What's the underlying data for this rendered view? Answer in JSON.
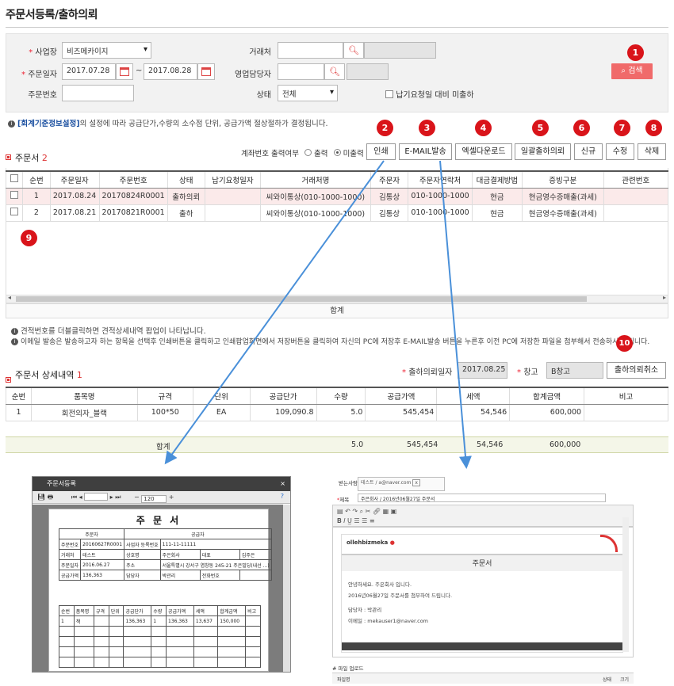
{
  "page_title": "주문서등록/출하의뢰",
  "search": {
    "business_label": "사업장",
    "business_value": "비즈메카이지",
    "order_date_label": "주문일자",
    "date_from": "2017.07.28",
    "date_to": "2017.08.28",
    "date_sep": "~",
    "order_no_label": "주문번호",
    "client_label": "거래처",
    "sales_rep_label": "영업담당자",
    "status_label": "상태",
    "status_value": "전체",
    "undelivered_label": "납기요청일 대비 미출하",
    "search_button": "검색",
    "search_icon": "magnifier-icon"
  },
  "info_line": {
    "link": "[회계기준정보설정]",
    "text": "의 설정에 따라 공급단가,수량의 소수점 단위, 공급가액 절상절하가 결정됩니다."
  },
  "orders": {
    "title": "주문서",
    "count": "2",
    "account_print_label": "계좌번호 출력여부",
    "radio_print": "출력",
    "radio_noprint": "미출력",
    "buttons": {
      "print": "인쇄",
      "email": "E-MAIL발송",
      "excel": "엑셀다운로드",
      "bulk": "일괄출하의뢰",
      "new": "신규",
      "edit": "수정",
      "delete": "삭제"
    },
    "columns": [
      "순번",
      "주문일자",
      "주문번호",
      "상태",
      "납기요청일자",
      "거래처명",
      "주문자",
      "주문자연락처",
      "대금결제방법",
      "증빙구분",
      "관련번호"
    ],
    "rows": [
      [
        "1",
        "2017.08.24",
        "20170824R0001",
        "출하의뢰",
        "",
        "씨와이통상(010-1000-1000)",
        "김통상",
        "010-1000-1000",
        "현금",
        "현금영수증매출(과세)",
        ""
      ],
      [
        "2",
        "2017.08.21",
        "20170821R0001",
        "출하",
        "",
        "씨와이통상(010-1000-1000)",
        "김통상",
        "010-1000-1000",
        "현금",
        "현금영수증매출(과세)",
        ""
      ]
    ],
    "sum_label": "합계"
  },
  "notes": [
    "견적번호를 더블클릭하면 견적상세내역 팝업이 나타납니다.",
    "이메일 발송은 발송하고자 하는 항목을 선택후 인쇄버튼을 클릭하고 인쇄팝업화면에서 저장버튼을 클릭하여 자신의 PC에 저장후 E-MAIL발송 버튼을 누른후 이전 PC에 저장한 파일을 첨부해서 전송하시면 됩니다."
  ],
  "detail": {
    "title": "주문서 상세내역",
    "count": "1",
    "request_date_label": "출하의뢰일자",
    "request_date": "2017.08.25",
    "warehouse_label": "창고",
    "warehouse": "B창고",
    "cancel_button": "출하의뢰취소",
    "columns": [
      "순번",
      "품목명",
      "규격",
      "단위",
      "공급단가",
      "수량",
      "공급가액",
      "세액",
      "합계금액",
      "비고"
    ],
    "rows": [
      [
        "1",
        "회전의자_블랙",
        "100*50",
        "EA",
        "109,090.8",
        "5.0",
        "545,454",
        "54,546",
        "600,000",
        ""
      ]
    ],
    "sum": {
      "label": "합계",
      "qty": "5.0",
      "supply": "545,454",
      "tax": "54,546",
      "total": "600,000"
    }
  },
  "badges": [
    "1",
    "2",
    "3",
    "4",
    "5",
    "6",
    "7",
    "8",
    "9",
    "10"
  ],
  "print_popup": {
    "window_title": "주문서등록",
    "doc_title": "주 문 서",
    "buyer": "주문자",
    "supplier": "공급자",
    "row1": [
      "주문번호",
      "20160627R0001",
      "사업자 등록번호",
      "111-11-11111"
    ],
    "row2": [
      "거래처",
      "테스트",
      "상호명",
      "주은회사",
      "대표",
      "김주은"
    ],
    "row3": [
      "주문일자",
      "2016.06.27",
      "주소",
      "서울특별시 강서구 염창동 245-21 주은빌딩(내선 ...)"
    ],
    "row4": [
      "공급가액",
      "136,363",
      "담당자",
      "박관리",
      "전화번호",
      ""
    ],
    "cols": [
      "순번",
      "품목명",
      "규격",
      "단위",
      "공급단가",
      "수량",
      "공급가액",
      "세액",
      "합계금액",
      "비고"
    ],
    "item": [
      "1",
      "책",
      "",
      "",
      "136,363",
      "1",
      "136,363",
      "13,637",
      "150,000",
      ""
    ],
    "zoom": "120"
  },
  "email_popup": {
    "receiver_label": "받는사람",
    "receiver_hint": "테스트 / a@naver.com",
    "receiver_tag": "x",
    "subject_label": "제목",
    "subject_value": "주은회사 / 2016년06월27일 주문서",
    "brand": "ollehbizmeka",
    "header": "주문서",
    "body_lines": [
      "안녕하세요. 주은회사 입니다.",
      "2016년06월27일 주문서를 첨부하여 드립니다.",
      "담당자 : 박관리",
      "이메일 : mekauser1@naver.com"
    ],
    "upload_label": "파일 업로드",
    "file_col": "파일명",
    "state_col": "상태",
    "size_col": "크기"
  }
}
